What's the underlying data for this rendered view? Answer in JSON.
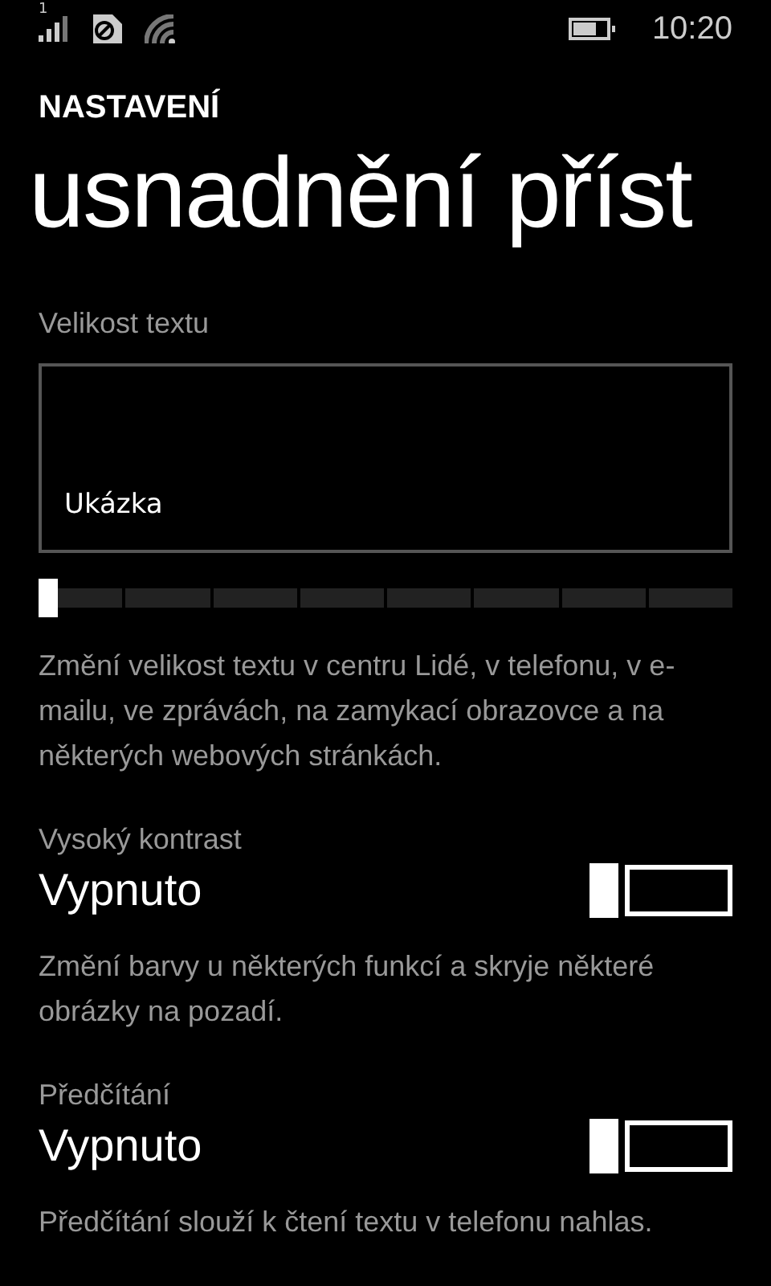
{
  "status_bar": {
    "sim_label": "1",
    "time": "10:20"
  },
  "app_title": "NASTAVENÍ",
  "page_title": "usnadnění příst",
  "text_size": {
    "label": "Velikost textu",
    "sample": "Ukázka",
    "level": 0,
    "description": "Změní velikost textu v centru Lidé, v telefonu, v e-mailu, ve zprávách, na zamykací obrazovce a na některých webových stránkách."
  },
  "settings": [
    {
      "label": "Vysoký kontrast",
      "value": "Vypnuto",
      "on": false,
      "description": "Změní barvy u některých funkcí a skryje některé obrázky na pozadí."
    },
    {
      "label": "Předčítání",
      "value": "Vypnuto",
      "on": false,
      "description": "Předčítání slouží k čtení textu v telefonu nahlas."
    }
  ]
}
